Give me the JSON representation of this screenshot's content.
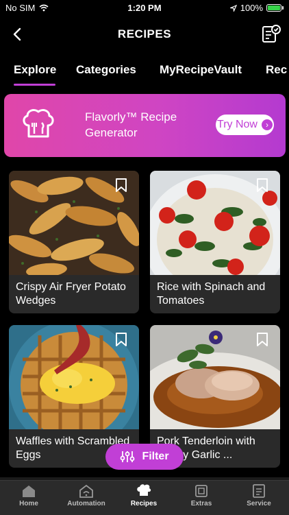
{
  "status_bar": {
    "carrier": "No SIM",
    "time": "1:20 PM",
    "battery": "100%"
  },
  "header": {
    "title": "RECIPES"
  },
  "tabs": [
    {
      "label": "Explore"
    },
    {
      "label": "Categories"
    },
    {
      "label": "MyRecipeVault"
    },
    {
      "label": "Rec"
    }
  ],
  "banner": {
    "title": "Flavorly™ Recipe Generator",
    "button_label": "Try Now"
  },
  "recipes": [
    {
      "title": "Crispy Air Fryer Potato Wedges"
    },
    {
      "title": "Rice with Spinach and Tomatoes"
    },
    {
      "title": "Waffles with Scrambled Eggs"
    },
    {
      "title": "Pork Tenderloin with Honey Garlic ..."
    }
  ],
  "filter": {
    "label": "Filter"
  },
  "tabbar": [
    {
      "label": "Home"
    },
    {
      "label": "Automation"
    },
    {
      "label": "Recipes"
    },
    {
      "label": "Extras"
    },
    {
      "label": "Service"
    }
  ],
  "colors": {
    "accent": "#c13fd6",
    "banner_start": "#e046a9",
    "battery": "#37d34a"
  }
}
